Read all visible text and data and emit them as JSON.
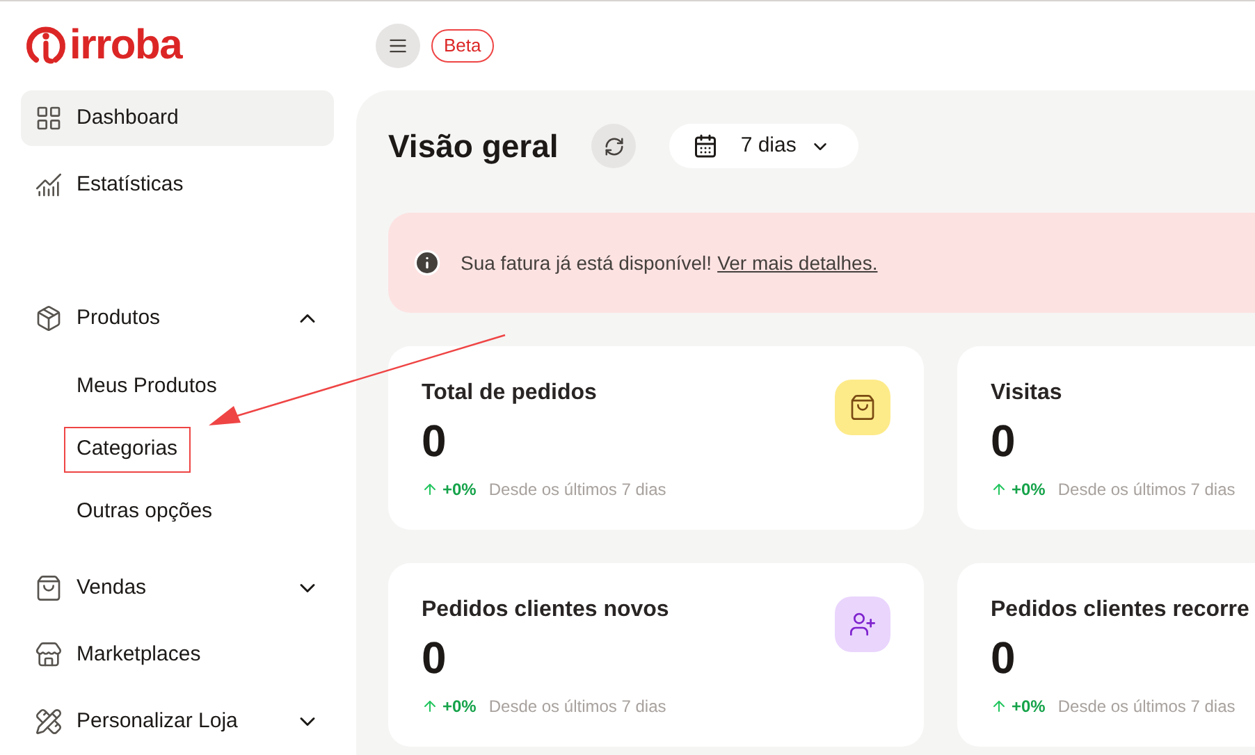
{
  "brand": {
    "name": "irroba"
  },
  "badge": "Beta",
  "sidebar": {
    "items": [
      {
        "label": "Dashboard",
        "selected": true
      },
      {
        "label": "Estatísticas",
        "selected": false
      },
      {
        "label": "Produtos",
        "selected": false,
        "expanded": true,
        "children": [
          {
            "label": "Meus Produtos",
            "highlighted": false
          },
          {
            "label": "Categorias",
            "highlighted": true
          },
          {
            "label": "Outras opções",
            "highlighted": false
          }
        ]
      },
      {
        "label": "Vendas",
        "selected": false,
        "expanded": false
      },
      {
        "label": "Marketplaces",
        "selected": false
      },
      {
        "label": "Personalizar Loja",
        "selected": false,
        "expanded": false
      }
    ]
  },
  "page": {
    "title": "Visão geral",
    "period": "7 dias"
  },
  "alert": {
    "text": "Sua fatura já está disponível!",
    "link": "Ver mais detalhes."
  },
  "cards": [
    {
      "title": "Total de pedidos",
      "value": "0",
      "change": "+0%",
      "note": "Desde os últimos 7 dias",
      "color": "#fdeb8a"
    },
    {
      "title": "Visitas",
      "value": "0",
      "change": "+0%",
      "note": "Desde os últimos 7 dias"
    },
    {
      "title": "Pedidos clientes novos",
      "value": "0",
      "change": "+0%",
      "note": "Desde os últimos 7 dias",
      "color": "#ead5fd"
    },
    {
      "title": "Pedidos clientes recorre",
      "value": "0",
      "change": "+0%",
      "note": "Desde os últimos 7 dias"
    }
  ]
}
